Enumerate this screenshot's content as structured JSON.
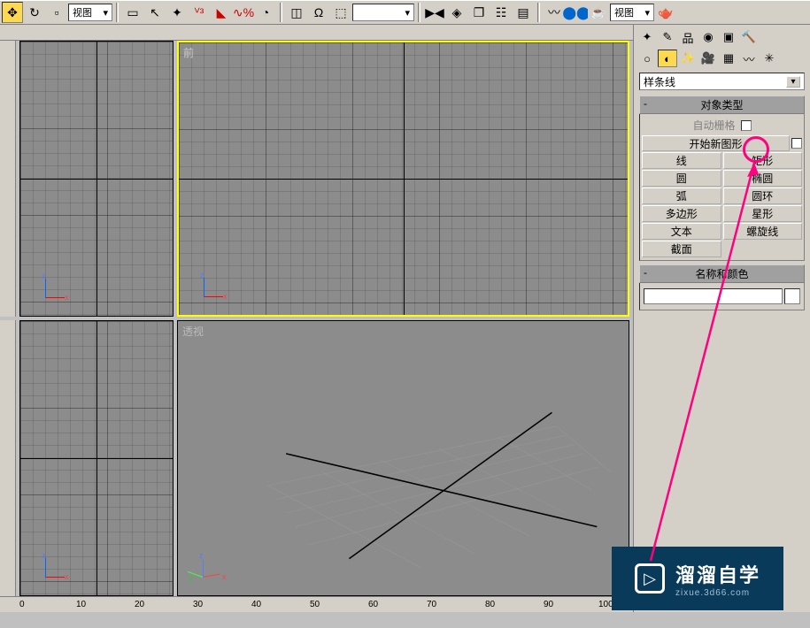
{
  "toolbar": {
    "view_dropdown1": "视图",
    "view_dropdown2": "视图"
  },
  "viewports": {
    "top_left_label": "",
    "front_label": "前",
    "bottom_left_label": "",
    "perspective_label": "透视"
  },
  "ruler": {
    "t0": "0",
    "t10": "10",
    "t20": "20",
    "t30": "30",
    "t40": "40",
    "t50": "50",
    "t60": "60",
    "t70": "70",
    "t80": "80",
    "t90": "90",
    "t100": "100"
  },
  "side": {
    "dropdown": "样条线",
    "object_type_header": "对象类型",
    "autogrid_label": "自动栅格",
    "start_new_shape": "开始新图形",
    "shapes": {
      "line": "线",
      "rectangle": "矩形",
      "circle": "圆",
      "ellipse": "椭圆",
      "arc": "弧",
      "donut": "圆环",
      "ngon": "多边形",
      "star": "星形",
      "text": "文本",
      "helix": "螺旋线",
      "section": "截面"
    },
    "name_color_header": "名称和颜色"
  },
  "watermark": {
    "main": "溜溜自学",
    "sub": "zixue.3d66.com"
  },
  "gizmo": {
    "x": "x",
    "z": "z",
    "y": "y"
  }
}
